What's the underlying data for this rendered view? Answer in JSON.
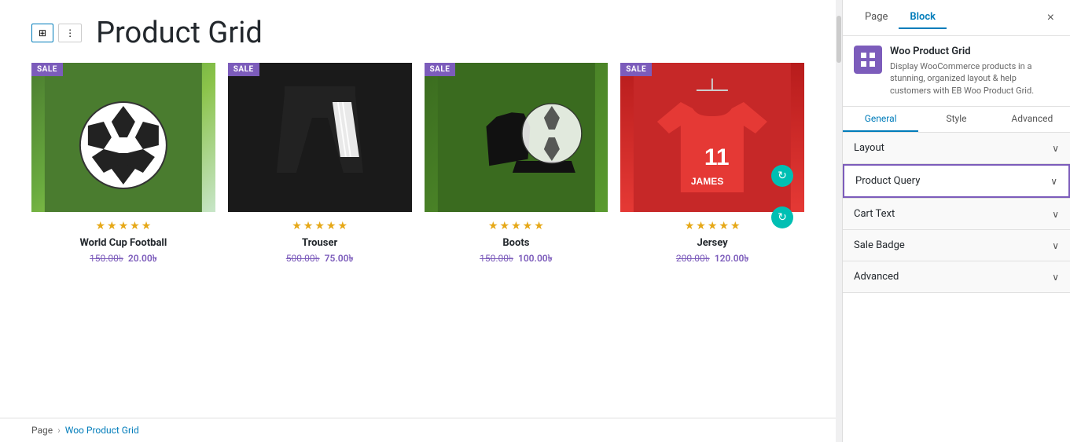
{
  "sidebar": {
    "tabs": [
      {
        "label": "Page",
        "active": false
      },
      {
        "label": "Block",
        "active": true
      }
    ],
    "close_label": "×",
    "block_info": {
      "title": "Woo Product Grid",
      "description": "Display WooCommerce products in a stunning, organized layout & help customers with EB Woo Product Grid."
    },
    "inspector_tabs": [
      {
        "label": "General",
        "active": true
      },
      {
        "label": "Style",
        "active": false
      },
      {
        "label": "Advanced",
        "active": false
      }
    ],
    "accordion_panels": [
      {
        "label": "Layout",
        "active": false
      },
      {
        "label": "Product Query",
        "active": true
      },
      {
        "label": "Cart Text",
        "active": false
      },
      {
        "label": "Sale Badge",
        "active": false
      },
      {
        "label": "Advanced",
        "active": false
      }
    ]
  },
  "canvas": {
    "title": "Product Grid",
    "breadcrumb": {
      "page": "Page",
      "separator": "›",
      "current": "Woo Product Grid"
    }
  },
  "products": [
    {
      "name": "World Cup Football",
      "sale_badge": "SALE",
      "original_price": "150.00৳",
      "sale_price": "20.00৳",
      "stars": 5
    },
    {
      "name": "Trouser",
      "sale_badge": "SALE",
      "original_price": "500.00৳",
      "sale_price": "75.00৳",
      "stars": 5
    },
    {
      "name": "Boots",
      "sale_badge": "SALE",
      "original_price": "150.00৳",
      "sale_price": "100.00৳",
      "stars": 5
    },
    {
      "name": "Jersey",
      "sale_badge": "SALE",
      "original_price": "200.00৳",
      "sale_price": "120.00৳",
      "stars": 5
    }
  ],
  "icons": {
    "refresh": "↻",
    "chevron_down": "∨",
    "grid": "⊞",
    "dots": "⋮",
    "close": "×"
  }
}
